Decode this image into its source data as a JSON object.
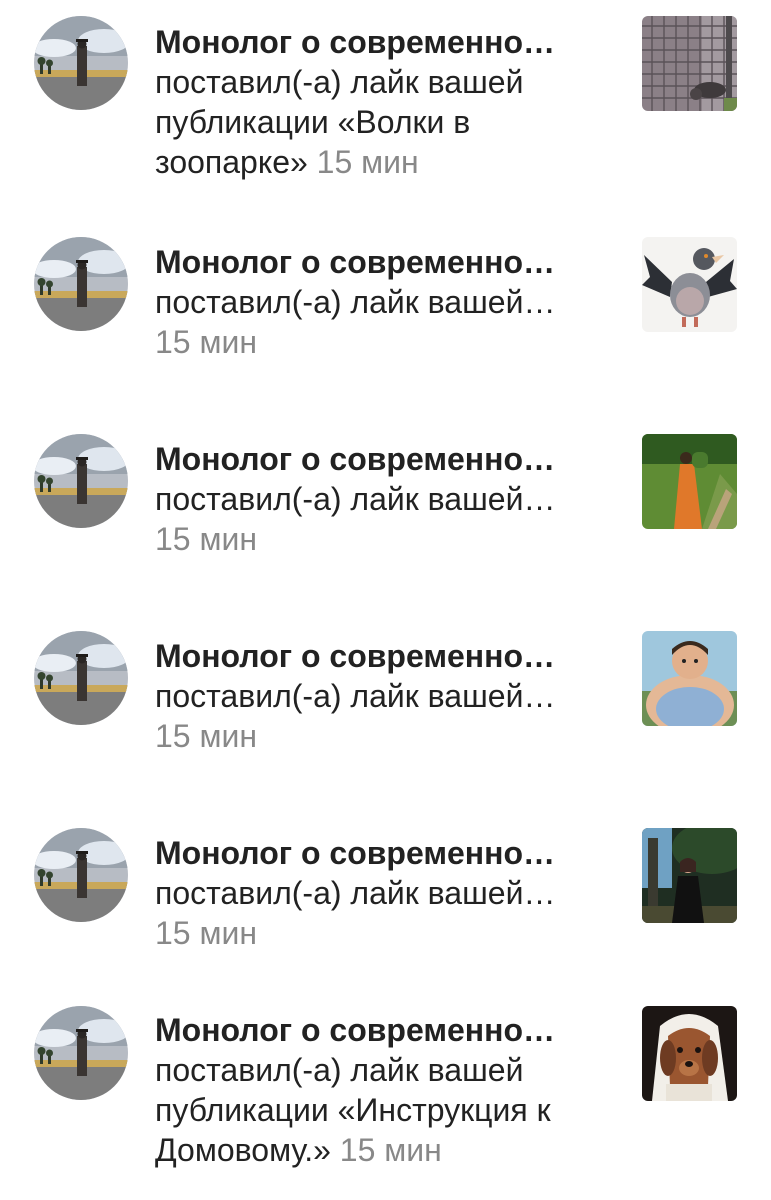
{
  "notifications": [
    {
      "author": "Монолог о современно…",
      "action": "поставил(-а) лайк вашей публикации «Волки в зоопарке»",
      "time": "15 мин",
      "thumb_icon": "wolf-cage-thumbnail"
    },
    {
      "author": "Монолог о современно…",
      "action": "поставил(-а) лайк вашей…",
      "time": "15 мин",
      "thumb_icon": "pigeon-thumbnail"
    },
    {
      "author": "Монолог о современно…",
      "action": "поставил(-а) лайк вашей…",
      "time": "15 мин",
      "thumb_icon": "woman-in-field-thumbnail"
    },
    {
      "author": "Монолог о современно…",
      "action": "поставил(-а) лайк вашей…",
      "time": "15 мин",
      "thumb_icon": "fat-man-thumbnail"
    },
    {
      "author": "Монолог о современно…",
      "action": "поставил(-а) лайк вашей…",
      "time": "15 мин",
      "thumb_icon": "woman-by-tree-thumbnail"
    },
    {
      "author": "Монолог о современно…",
      "action": "поставил(-а) лайк вашей публикации «Инструкция к Домовому.»",
      "time": "15 мин",
      "thumb_icon": "dog-in-veil-thumbnail"
    }
  ],
  "avatar_icon": "man-in-field-avatar"
}
